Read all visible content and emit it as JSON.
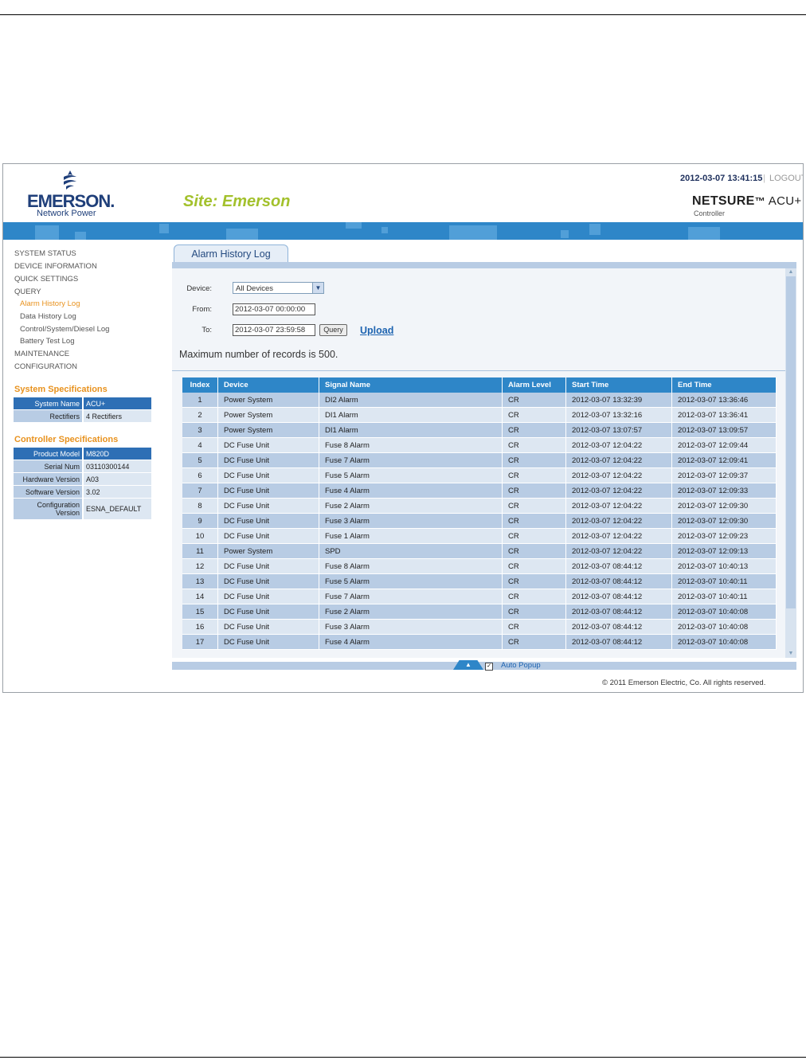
{
  "header": {
    "brand": "EMERSON.",
    "brand_sub": "Network Power",
    "site_title": "Site: Emerson",
    "datetime": "2012-03-07 13:41:15",
    "logout": "LOGOUT",
    "product_name_a": "NETSURE",
    "product_name_b": "ACU+",
    "product_sub": "Controller"
  },
  "nav": {
    "items": [
      {
        "label": "SYSTEM STATUS"
      },
      {
        "label": "DEVICE INFORMATION"
      },
      {
        "label": "QUICK SETTINGS"
      },
      {
        "label": "QUERY"
      },
      {
        "label": "Alarm History Log"
      },
      {
        "label": "Data History Log"
      },
      {
        "label": "Control/System/Diesel Log"
      },
      {
        "label": "Battery Test Log"
      },
      {
        "label": "MAINTENANCE"
      },
      {
        "label": "CONFIGURATION"
      }
    ]
  },
  "system_specs": {
    "title": "System Specifications",
    "rows": [
      {
        "k": "System Name",
        "v": "ACU+"
      },
      {
        "k": "Rectifiers",
        "v": "4 Rectifiers"
      }
    ]
  },
  "controller_specs": {
    "title": "Controller Specifications",
    "rows": [
      {
        "k": "Product Model",
        "v": "M820D"
      },
      {
        "k": "Serial Num",
        "v": "03110300144"
      },
      {
        "k": "Hardware Version",
        "v": "A03"
      },
      {
        "k": "Software Version",
        "v": "3.02"
      },
      {
        "k": "Configuration Version",
        "v": "ESNA_DEFAULT"
      }
    ]
  },
  "main": {
    "tab": "Alarm History Log",
    "device_label": "Device:",
    "device_value": "All Devices",
    "from_label": "From:",
    "from_value": "2012-03-07 00:00:00",
    "to_label": "To:",
    "to_value": "2012-03-07 23:59:58",
    "query_button": "Query",
    "upload_link": "Upload",
    "max_records": "Maximum number of records is 500."
  },
  "table": {
    "headers": [
      "Index",
      "Device",
      "Signal Name",
      "Alarm Level",
      "Start Time",
      "End Time"
    ],
    "rows": [
      [
        "1",
        "Power System",
        "DI2 Alarm",
        "CR",
        "2012-03-07 13:32:39",
        "2012-03-07 13:36:46"
      ],
      [
        "2",
        "Power System",
        "DI1 Alarm",
        "CR",
        "2012-03-07 13:32:16",
        "2012-03-07 13:36:41"
      ],
      [
        "3",
        "Power System",
        "DI1 Alarm",
        "CR",
        "2012-03-07 13:07:57",
        "2012-03-07 13:09:57"
      ],
      [
        "4",
        "DC Fuse Unit",
        "Fuse 8 Alarm",
        "CR",
        "2012-03-07 12:04:22",
        "2012-03-07 12:09:44"
      ],
      [
        "5",
        "DC Fuse Unit",
        "Fuse 7 Alarm",
        "CR",
        "2012-03-07 12:04:22",
        "2012-03-07 12:09:41"
      ],
      [
        "6",
        "DC Fuse Unit",
        "Fuse 5 Alarm",
        "CR",
        "2012-03-07 12:04:22",
        "2012-03-07 12:09:37"
      ],
      [
        "7",
        "DC Fuse Unit",
        "Fuse 4 Alarm",
        "CR",
        "2012-03-07 12:04:22",
        "2012-03-07 12:09:33"
      ],
      [
        "8",
        "DC Fuse Unit",
        "Fuse 2 Alarm",
        "CR",
        "2012-03-07 12:04:22",
        "2012-03-07 12:09:30"
      ],
      [
        "9",
        "DC Fuse Unit",
        "Fuse 3 Alarm",
        "CR",
        "2012-03-07 12:04:22",
        "2012-03-07 12:09:30"
      ],
      [
        "10",
        "DC Fuse Unit",
        "Fuse 1 Alarm",
        "CR",
        "2012-03-07 12:04:22",
        "2012-03-07 12:09:23"
      ],
      [
        "11",
        "Power System",
        "SPD",
        "CR",
        "2012-03-07 12:04:22",
        "2012-03-07 12:09:13"
      ],
      [
        "12",
        "DC Fuse Unit",
        "Fuse 8 Alarm",
        "CR",
        "2012-03-07 08:44:12",
        "2012-03-07 10:40:13"
      ],
      [
        "13",
        "DC Fuse Unit",
        "Fuse 5 Alarm",
        "CR",
        "2012-03-07 08:44:12",
        "2012-03-07 10:40:11"
      ],
      [
        "14",
        "DC Fuse Unit",
        "Fuse 7 Alarm",
        "CR",
        "2012-03-07 08:44:12",
        "2012-03-07 10:40:11"
      ],
      [
        "15",
        "DC Fuse Unit",
        "Fuse 2 Alarm",
        "CR",
        "2012-03-07 08:44:12",
        "2012-03-07 10:40:08"
      ],
      [
        "16",
        "DC Fuse Unit",
        "Fuse 3 Alarm",
        "CR",
        "2012-03-07 08:44:12",
        "2012-03-07 10:40:08"
      ],
      [
        "17",
        "DC Fuse Unit",
        "Fuse 4 Alarm",
        "CR",
        "2012-03-07 08:44:12",
        "2012-03-07 10:40:08"
      ]
    ]
  },
  "footer": {
    "auto_popup": "Auto Popup",
    "copyright": "© 2011 Emerson Electric, Co. All rights reserved."
  },
  "colors": {
    "accent_blue": "#2e86c8",
    "nav_active": "#e8921e",
    "site_title": "#a3c12c",
    "row_dark": "#b8cce4",
    "row_light": "#dde7f2"
  }
}
